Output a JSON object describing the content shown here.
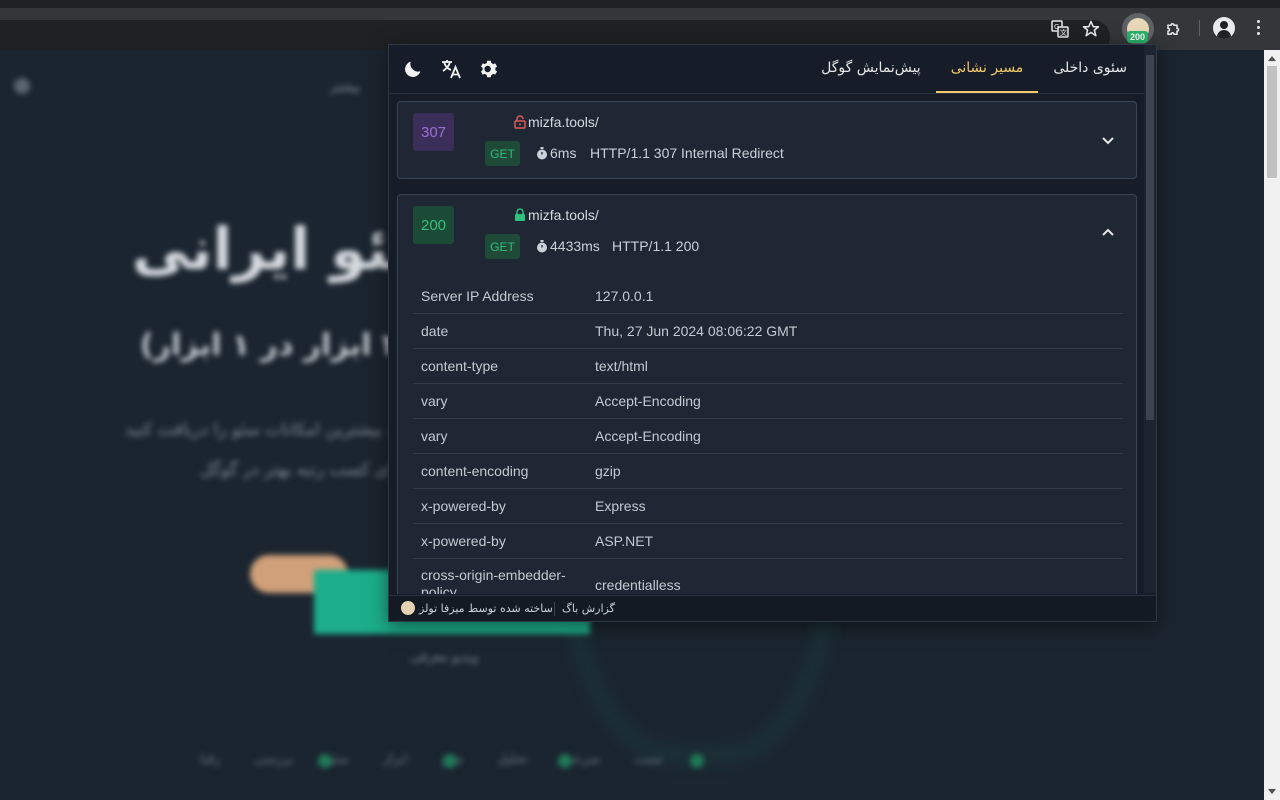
{
  "browser": {
    "extension_badge": "200"
  },
  "background_page": {
    "nav_text": "بیشتر",
    "hero_title": "سئو ایرانی",
    "hero_subtitle": "ابزار جامع سئو (۴ ابزار در ۱ ابزار)",
    "desc_line1": "با کمترین هزینه بیشترین امکانات سئو را دریافت کنید",
    "desc_line2": "برای کسب رتبه بهتر در گوگل",
    "video_link": "ویدیو معرفی",
    "features": "تست سرعت  تحلیل سئو  ابزار سئو  بررسی رقبا"
  },
  "popup": {
    "tabs": [
      {
        "label": "سئوی داخلی",
        "active": false
      },
      {
        "label": "مسیر نشانی",
        "active": true
      },
      {
        "label": "پیش‌نمایش گوگل",
        "active": false
      }
    ],
    "header_icons": [
      "dark-mode-icon",
      "translate-icon",
      "settings-icon"
    ],
    "redirects": [
      {
        "status": "307",
        "secure": false,
        "url": "mizfa.tools/",
        "method": "GET",
        "time": "6ms",
        "protocol_status": "HTTP/1.1 307 Internal Redirect",
        "expanded": false
      },
      {
        "status": "200",
        "secure": true,
        "url": "mizfa.tools/",
        "method": "GET",
        "time": "4433ms",
        "protocol_status": "HTTP/1.1 200",
        "expanded": true,
        "headers": [
          {
            "key": "Server IP Address",
            "value": "127.0.0.1"
          },
          {
            "key": "date",
            "value": "Thu, 27 Jun 2024 08:06:22 GMT"
          },
          {
            "key": "content-type",
            "value": "text/html"
          },
          {
            "key": "vary",
            "value": "Accept-Encoding"
          },
          {
            "key": "vary",
            "value": "Accept-Encoding"
          },
          {
            "key": "content-encoding",
            "value": "gzip"
          },
          {
            "key": "x-powered-by",
            "value": "Express"
          },
          {
            "key": "x-powered-by",
            "value": "ASP.NET"
          },
          {
            "key": "cross-origin-embedder-policy",
            "value": "credentialless"
          }
        ]
      }
    ],
    "footer": {
      "made_by": "ساخته شده توسط میزفا تولز",
      "bug_report": "گزارش باگ"
    }
  },
  "colors": {
    "accent_tab": "#f3c969",
    "status_307": "#9b6fd8",
    "status_200": "#34c17b",
    "insecure_lock": "#e05a5a",
    "secure_lock": "#2dbf7b"
  }
}
